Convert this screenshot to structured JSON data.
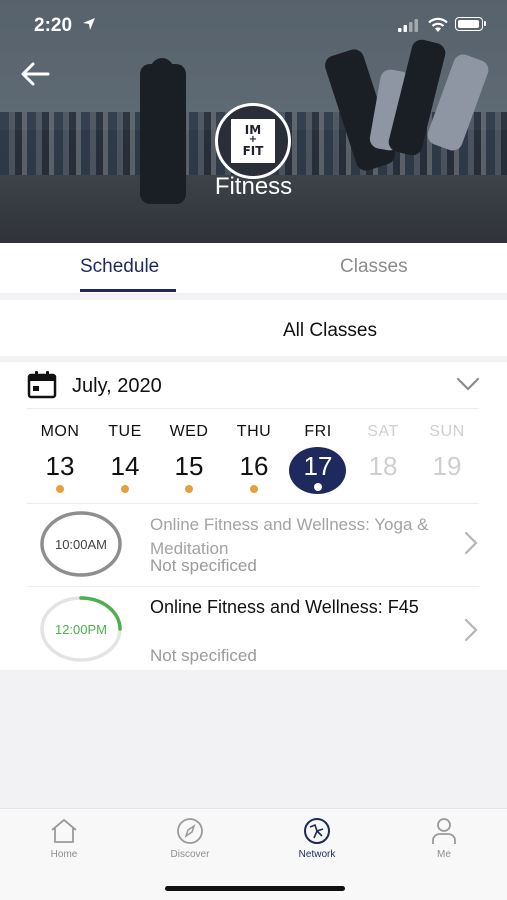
{
  "status_bar": {
    "time": "2:20"
  },
  "hero": {
    "title": "Fitness",
    "logo_text": [
      "IM",
      "+",
      "FIT"
    ]
  },
  "tabs": [
    {
      "label": "Schedule",
      "active": true
    },
    {
      "label": "Classes",
      "active": false
    }
  ],
  "filter": {
    "label": "All Classes"
  },
  "calendar": {
    "month": "July,  2020",
    "days": [
      {
        "name": "MON",
        "date": "13",
        "has_event": true,
        "selected": false,
        "muted": false
      },
      {
        "name": "TUE",
        "date": "14",
        "has_event": true,
        "selected": false,
        "muted": false
      },
      {
        "name": "WED",
        "date": "15",
        "has_event": true,
        "selected": false,
        "muted": false
      },
      {
        "name": "THU",
        "date": "16",
        "has_event": true,
        "selected": false,
        "muted": false
      },
      {
        "name": "FRI",
        "date": "17",
        "has_event": true,
        "selected": true,
        "muted": false
      },
      {
        "name": "SAT",
        "date": "18",
        "has_event": false,
        "selected": false,
        "muted": true
      },
      {
        "name": "SUN",
        "date": "19",
        "has_event": false,
        "selected": false,
        "muted": true
      }
    ]
  },
  "events": [
    {
      "time": "10:00AM",
      "title": "Online Fitness and Wellness:  Yoga & Meditation",
      "location": "Not specificed",
      "past": true,
      "progress": 0
    },
    {
      "time": "12:00PM",
      "title": "Online Fitness and Wellness: F45",
      "location": "Not specificed",
      "past": false,
      "progress": 0.25
    }
  ],
  "nav": [
    {
      "label": "Home",
      "icon": "home-icon",
      "active": false
    },
    {
      "label": "Discover",
      "icon": "compass-icon",
      "active": false
    },
    {
      "label": "Network",
      "icon": "network-icon",
      "active": true
    },
    {
      "label": "Me",
      "icon": "person-icon",
      "active": false
    }
  ],
  "colors": {
    "primary": "#1e2a5e",
    "event_dot": "#e6a03a",
    "progress_green": "#4caf50",
    "muted_text": "#9a9a9a"
  }
}
